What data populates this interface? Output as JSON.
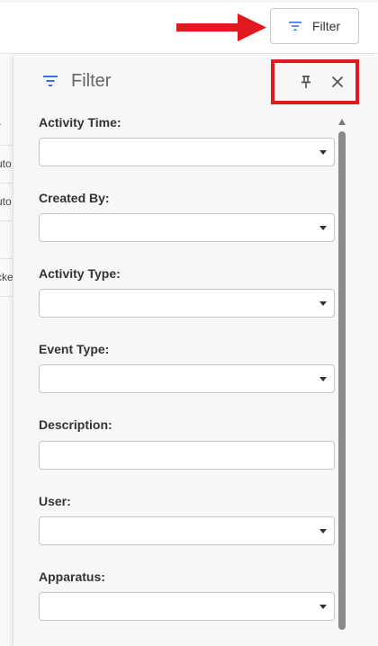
{
  "toolbar": {
    "filter_button_label": "Filter"
  },
  "background_table": {
    "rows": [
      "r",
      "uto",
      "uto",
      "",
      "cke",
      ""
    ]
  },
  "filter_panel": {
    "title": "Filter",
    "fields": [
      {
        "label": "Activity Time:",
        "type": "select",
        "value": ""
      },
      {
        "label": "Created By:",
        "type": "select",
        "value": ""
      },
      {
        "label": "Activity Type:",
        "type": "select",
        "value": ""
      },
      {
        "label": "Event Type:",
        "type": "select",
        "value": ""
      },
      {
        "label": "Description:",
        "type": "text",
        "value": ""
      },
      {
        "label": "User:",
        "type": "select",
        "value": ""
      },
      {
        "label": "Apparatus:",
        "type": "select",
        "value": ""
      }
    ]
  },
  "colors": {
    "accent": "#3b6fd8",
    "annotation": "#e1181f",
    "panel_bg": "#f7f7f7"
  }
}
